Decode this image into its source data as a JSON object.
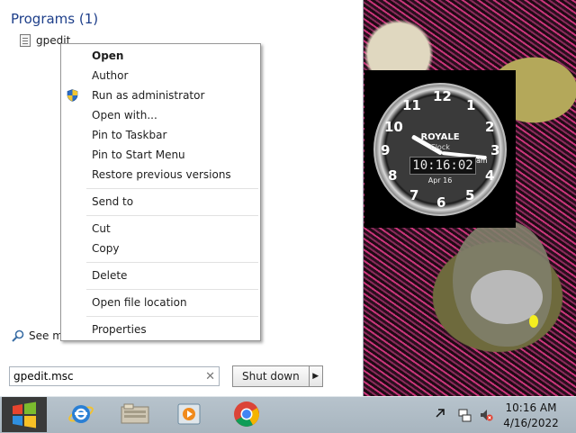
{
  "start_menu": {
    "programs_header": "Programs (1)",
    "program_item": "gpedit",
    "see_more": "See mo",
    "search_value": "gpedit.msc",
    "shutdown_label": "Shut down"
  },
  "context_menu": {
    "items": [
      {
        "label": "Open",
        "bold": true
      },
      {
        "label": "Author"
      },
      {
        "label": "Run as administrator",
        "icon": "uac-shield-icon"
      },
      {
        "label": "Open with..."
      },
      {
        "label": "Pin to Taskbar"
      },
      {
        "label": "Pin to Start Menu"
      },
      {
        "label": "Restore previous versions"
      },
      {
        "label": "Send to"
      },
      {
        "label": "Cut"
      },
      {
        "label": "Copy"
      },
      {
        "label": "Delete"
      },
      {
        "label": "Open file location"
      },
      {
        "label": "Properties"
      }
    ]
  },
  "clock_gadget": {
    "brand": "ROYALE",
    "subtitle": "Clock",
    "digital_time": "10:16:02",
    "ampm": "am",
    "date": "Apr 16",
    "numbers": [
      "12",
      "1",
      "2",
      "3",
      "4",
      "5",
      "6",
      "7",
      "8",
      "9",
      "10",
      "11"
    ]
  },
  "taskbar": {
    "pinned": [
      "internet-explorer-icon",
      "libraries-icon",
      "media-player-icon",
      "chrome-icon"
    ],
    "tray_time": "10:16 AM",
    "tray_date": "4/16/2022"
  },
  "colors": {
    "programs_header": "#1e3f8a",
    "taskbar": "#aab6c0",
    "chrome_red": "#db4437",
    "chrome_green": "#0f9d58",
    "chrome_yellow": "#f4b400",
    "chrome_blue": "#4285f4"
  }
}
